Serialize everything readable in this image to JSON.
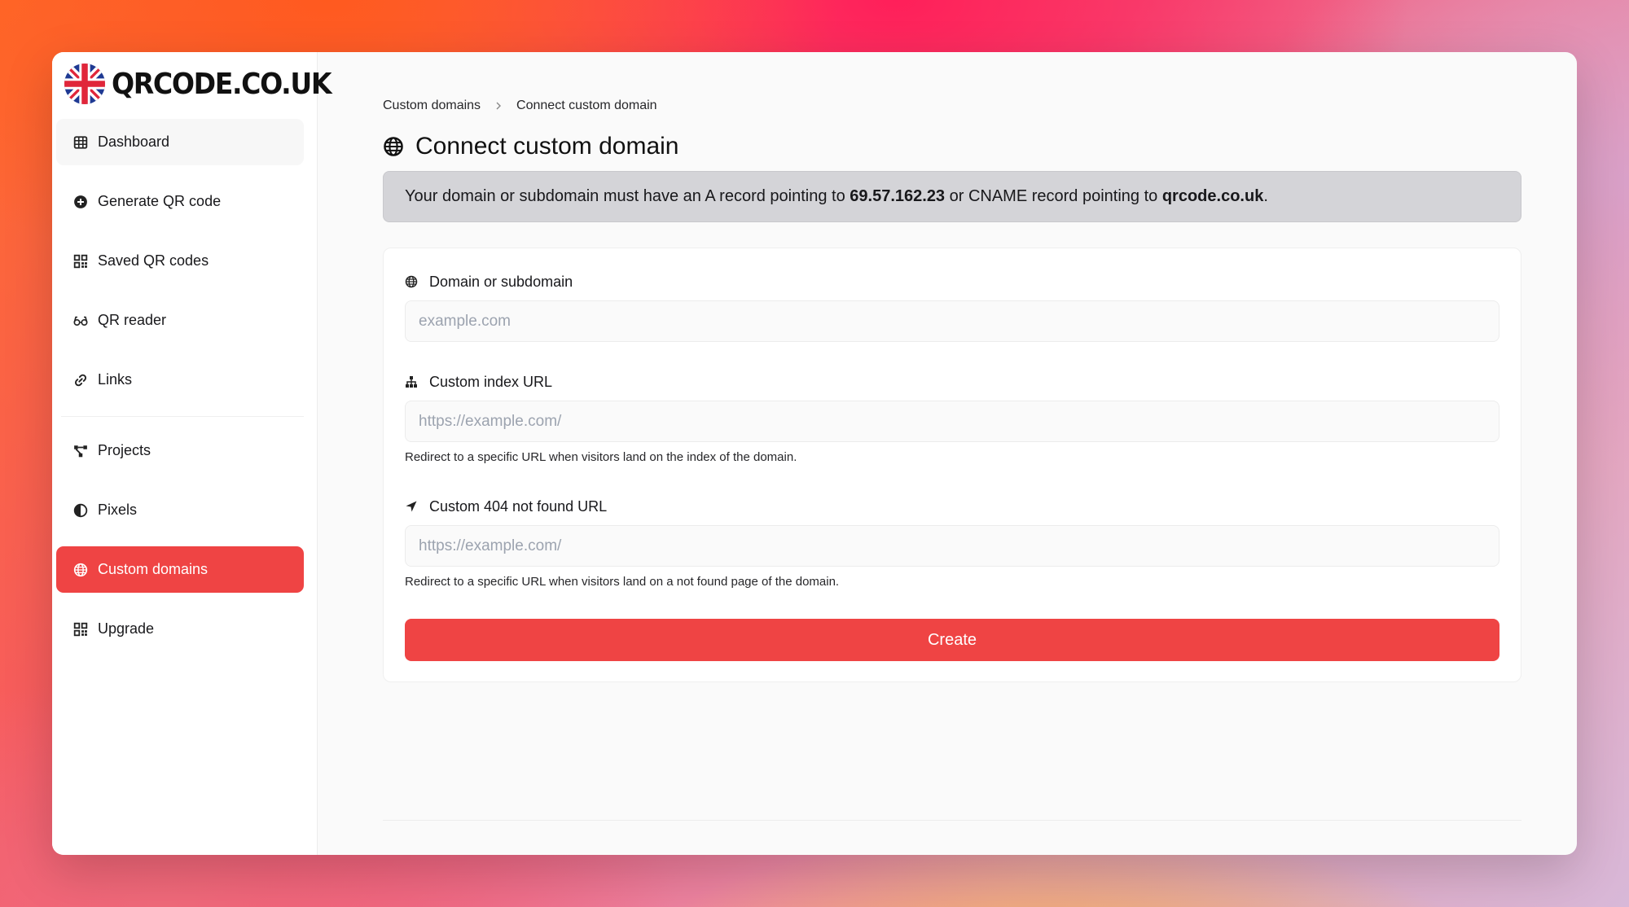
{
  "brand": {
    "name": "QRCODE.CO.UK"
  },
  "sidebar": {
    "items": [
      {
        "label": "Dashboard",
        "icon": "table-icon"
      },
      {
        "label": "Generate QR code",
        "icon": "plus-circle-icon"
      },
      {
        "label": "Saved QR codes",
        "icon": "qrcode-icon"
      },
      {
        "label": "QR reader",
        "icon": "glasses-icon"
      },
      {
        "label": "Links",
        "icon": "link-icon"
      },
      {
        "label": "Projects",
        "icon": "project-diagram-icon"
      },
      {
        "label": "Pixels",
        "icon": "half-circle-icon"
      },
      {
        "label": "Custom domains",
        "icon": "globe-icon",
        "active": true
      },
      {
        "label": "Upgrade",
        "icon": "qrcode-icon"
      }
    ]
  },
  "breadcrumb": {
    "parent": "Custom domains",
    "current": "Connect custom domain"
  },
  "page": {
    "title": "Connect custom domain"
  },
  "alert": {
    "prefix": "Your domain or subdomain must have an A record pointing to ",
    "ip": "69.57.162.23",
    "middle": " or CNAME record pointing to ",
    "host": "qrcode.co.uk",
    "suffix": "."
  },
  "form": {
    "domain": {
      "label": "Domain or subdomain",
      "placeholder": "example.com",
      "value": ""
    },
    "index_url": {
      "label": "Custom index URL",
      "placeholder": "https://example.com/",
      "value": "",
      "help": "Redirect to a specific URL when visitors land on the index of the domain."
    },
    "not_found_url": {
      "label": "Custom 404 not found URL",
      "placeholder": "https://example.com/",
      "value": "",
      "help": "Redirect to a specific URL when visitors land on a not found page of the domain."
    },
    "submit_label": "Create"
  },
  "colors": {
    "accent": "#ef4444",
    "alert_bg": "#d4d4d8"
  }
}
